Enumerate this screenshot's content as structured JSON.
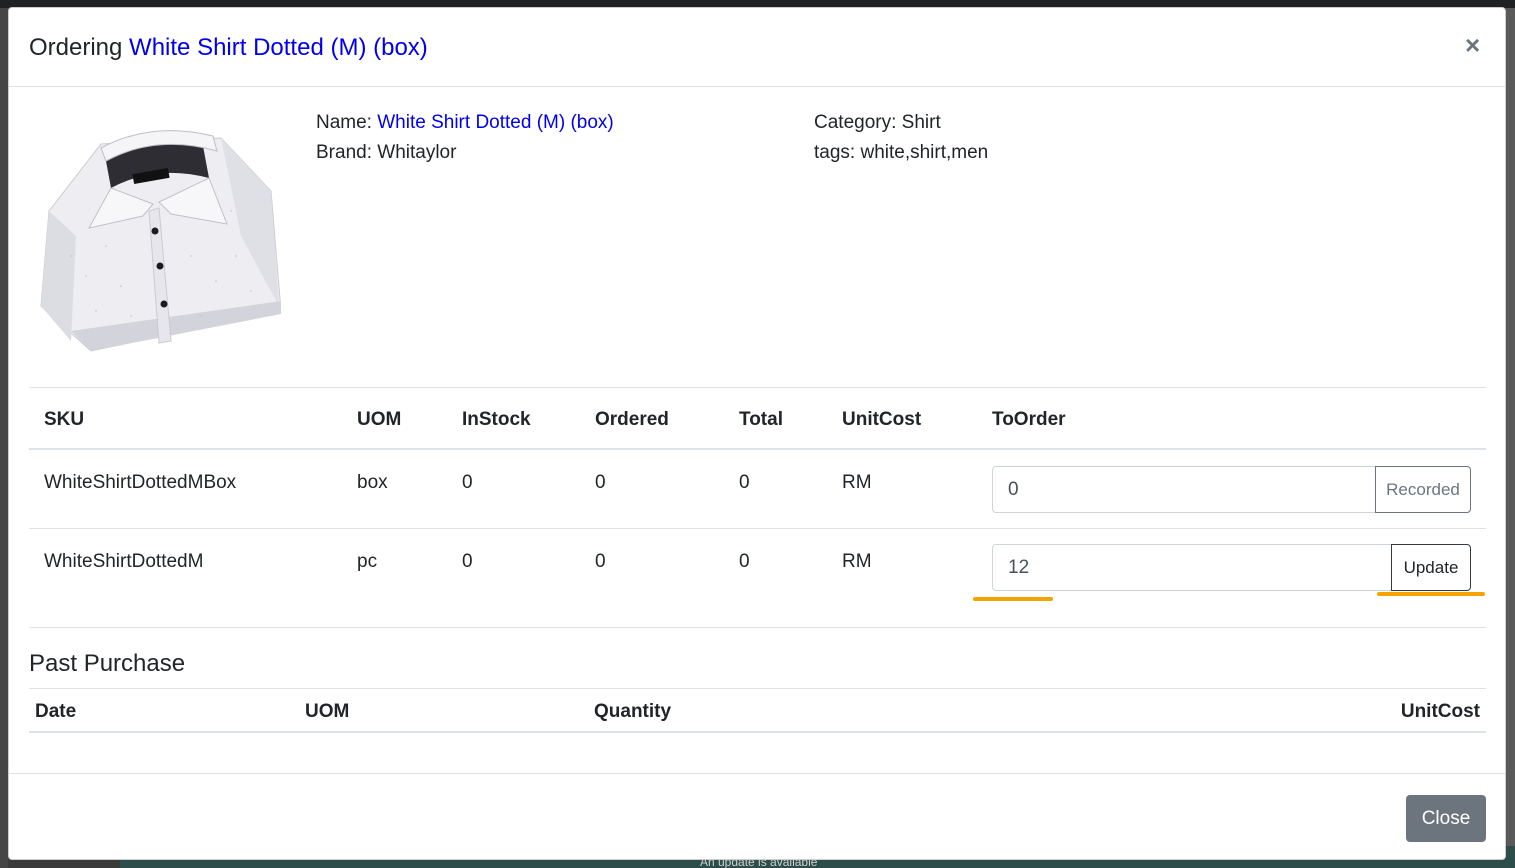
{
  "modal": {
    "title_prefix": "Ordering",
    "title_product": "White Shirt Dotted (M) (box)",
    "close_glyph": "×"
  },
  "product": {
    "name_label": "Name:",
    "name_value": "White Shirt Dotted (M) (box)",
    "brand_label": "Brand:",
    "brand_value": "Whitaylor",
    "category_label": "Category:",
    "category_value": "Shirt",
    "tags_label": "tags:",
    "tags_value": "white,shirt,men",
    "image_icon": "shirt-image"
  },
  "sku_table": {
    "headers": [
      "SKU",
      "UOM",
      "InStock",
      "Ordered",
      "Total",
      "UnitCost",
      "ToOrder"
    ],
    "rows": [
      {
        "sku": "WhiteShirtDottedMBox",
        "uom": "box",
        "instock": "0",
        "ordered": "0",
        "total": "0",
        "unitcost": "RM",
        "toorder": "0",
        "action": "Recorded"
      },
      {
        "sku": "WhiteShirtDottedM",
        "uom": "pc",
        "instock": "0",
        "ordered": "0",
        "total": "0",
        "unitcost": "RM",
        "toorder": "12",
        "action": "Update"
      }
    ]
  },
  "past_purchase": {
    "title": "Past Purchase",
    "headers": [
      "Date",
      "UOM",
      "Quantity",
      "UnitCost"
    ]
  },
  "footer": {
    "close_label": "Close"
  },
  "background": {
    "bottom_text": "An update is available"
  },
  "colors": {
    "link": "#0000ee",
    "highlight": "#f5a300",
    "close_button": "#6c757d"
  }
}
